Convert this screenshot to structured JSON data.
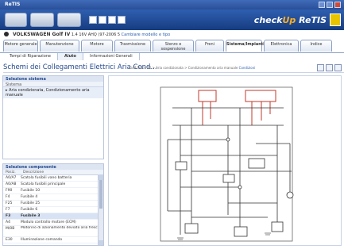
{
  "window": {
    "title": "ReTIS"
  },
  "brand": {
    "prefix": "check",
    "highlight": "Up",
    "suffix": " ReTIS"
  },
  "vehicle": {
    "label_bold": "VOLKSWAGEN Golf IV",
    "label_rest": " 1.4 16V AHQ (97-2006 5",
    "link": "Cambiare modello e tipo"
  },
  "main_tabs": [
    {
      "label": "Motore generale"
    },
    {
      "label": "Manutenzione"
    },
    {
      "label": "Motore"
    },
    {
      "label": "Trasmissione"
    },
    {
      "label": "Sterzo e sospensione"
    },
    {
      "label": "Freni"
    },
    {
      "label": "Sistema/Impianti"
    },
    {
      "label": "Elettronica"
    },
    {
      "label": "Indice"
    }
  ],
  "sub_tabs": [
    {
      "label": "Tempi di Riparazione"
    },
    {
      "label": "Aiuto"
    },
    {
      "label": "Informazioni Generali"
    }
  ],
  "headline": {
    "title": "Schemi dei Collegamenti Elettrici Aria Cond...",
    "crumb": "Golf IV 1.4 16 > Aria condizionata > Condizionamento aria manuale",
    "crumb_link": "Condizioni"
  },
  "selection_panel": {
    "header": "Selezione sistema",
    "column": "Sistema",
    "item": "▸ Aria condizionata, Condizionamento aria manuale"
  },
  "components_panel": {
    "header": "Selezione componente",
    "col_code": "Posiz.",
    "col_desc": "Descrizione",
    "rows": [
      {
        "code": "A0/A7",
        "desc": "Scatola fusibili vano batteria"
      },
      {
        "code": "A0/A8",
        "desc": "Scatola fusibili principale"
      },
      {
        "code": "F90",
        "desc": "Fusibile 10"
      },
      {
        "code": "F4",
        "desc": "Fusibile 4"
      },
      {
        "code": "F25",
        "desc": "Fusibile 25"
      },
      {
        "code": "F7",
        "desc": "Fusibile 6"
      },
      {
        "code": "F3",
        "desc": "Fusibile 3"
      },
      {
        "code": "A4",
        "desc": "Modulo controllo motore (ECM)"
      },
      {
        "code": "M/0B",
        "desc": "Motorino di azionamento deviato aria fresca"
      },
      {
        "code": "E30",
        "desc": "Illuminazione comando"
      }
    ]
  },
  "colors": {
    "accent": "#2a4f98",
    "brand_highlight": "#ffb020",
    "diagram_wire": "#333333",
    "diagram_red": "#c0392b"
  },
  "icons": {
    "search": "search-icon",
    "print": "print-icon",
    "zoom": "zoom-icon"
  }
}
